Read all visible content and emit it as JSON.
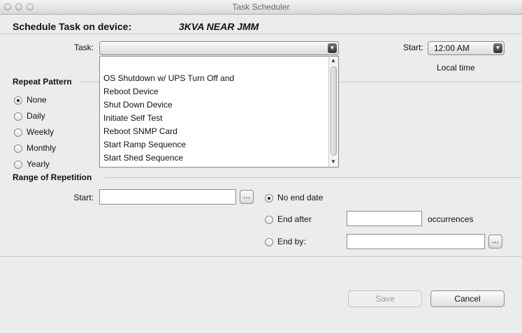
{
  "window": {
    "title": "Task Scheduler"
  },
  "header": {
    "label": "Schedule Task on device:",
    "device": "3KVA NEAR JMM"
  },
  "task": {
    "label": "Task:",
    "value": "",
    "options": [
      "OS Shutdown w/ UPS Turn Off and",
      "Reboot Device",
      "Shut Down Device",
      "Initiate Self Test",
      "Reboot SNMP Card",
      "Start Ramp Sequence",
      "Start Shed Sequence"
    ]
  },
  "start_time": {
    "label": "Start:",
    "value": "12:00 AM",
    "note": "Local time"
  },
  "repeat": {
    "title": "Repeat Pattern",
    "options": [
      "None",
      "Daily",
      "Weekly",
      "Monthly",
      "Yearly"
    ],
    "selected": "None"
  },
  "range": {
    "title": "Range of Repetition",
    "start_label": "Start:",
    "start_value": "",
    "browse_label": "...",
    "no_end": "No end date",
    "end_after": "End after",
    "occurrences_value": "",
    "occurrences_label": "occurrences",
    "end_by": "End by:",
    "end_by_value": ""
  },
  "buttons": {
    "save": "Save",
    "cancel": "Cancel"
  }
}
